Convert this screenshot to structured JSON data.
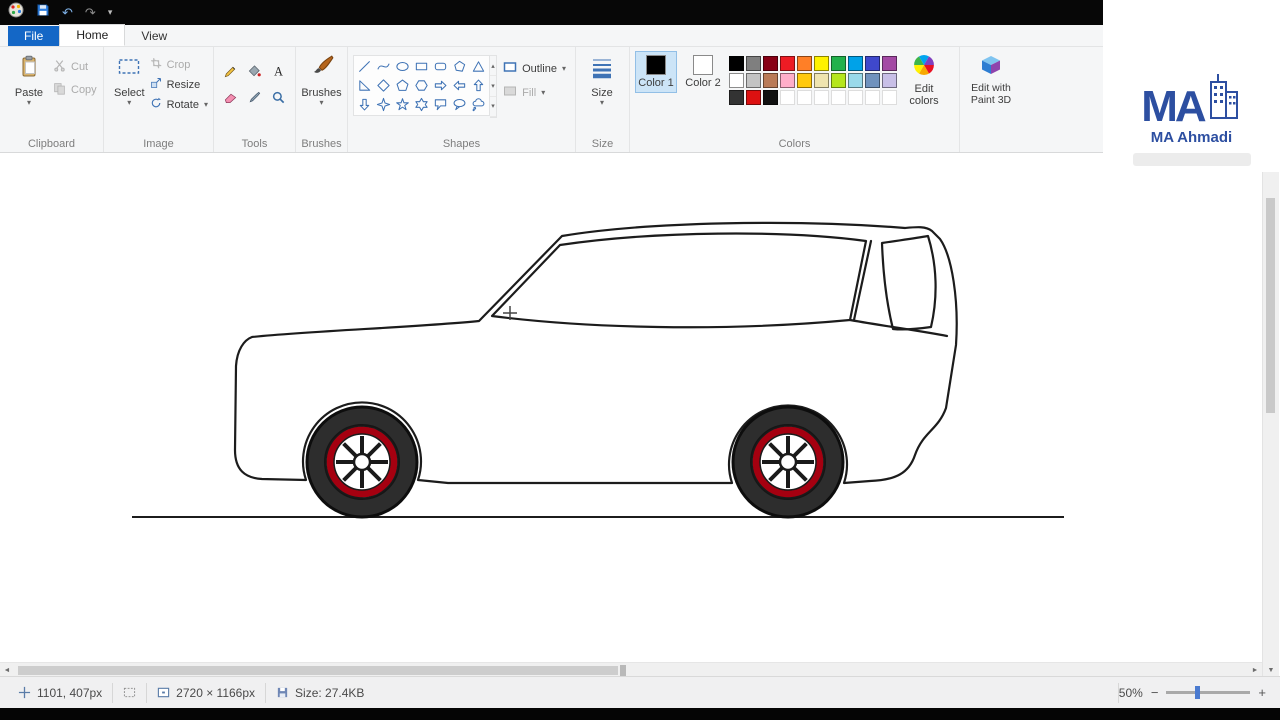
{
  "app": {
    "title": "Paint"
  },
  "titlebar": {
    "undo_glyph": "↶",
    "redo_glyph": "↷",
    "dropdown_glyph": "▾"
  },
  "tabs": {
    "file": "File",
    "home": "Home",
    "view": "View"
  },
  "ui": {
    "caret": "▾",
    "gallery_up": "▴",
    "gallery_down": "▾",
    "gallery_more": "▾"
  },
  "ribbon": {
    "clipboard": {
      "label": "Clipboard",
      "paste": "Paste",
      "cut": "Cut",
      "copy": "Copy"
    },
    "image": {
      "label": "Image",
      "select": "Select",
      "crop": "Crop",
      "resize": "Resize",
      "rotate": "Rotate"
    },
    "tools": {
      "label": "Tools",
      "items": [
        "pencil",
        "fill",
        "text",
        "eraser",
        "color-picker",
        "magnifier"
      ]
    },
    "brushes": {
      "label": "Brushes"
    },
    "shapes": {
      "label": "Shapes",
      "outline": "Outline",
      "fill": "Fill",
      "items": [
        "line",
        "curve",
        "oval",
        "rectangle",
        "rounded-rectangle",
        "polygon",
        "triangle",
        "right-triangle",
        "diamond",
        "pentagon",
        "hexagon",
        "arrow-right",
        "arrow-left",
        "arrow-up",
        "arrow-down",
        "star-4",
        "star-5",
        "star-6",
        "callout-rectangle",
        "callout-oval",
        "callout-cloud"
      ]
    },
    "size": {
      "label": "Size"
    },
    "colors": {
      "label": "Colors",
      "color1_label": "Color 1",
      "color1_value": "#000000",
      "color2_label": "Color 2",
      "color2_value": "#ffffff",
      "edit_colors": "Edit colors",
      "palette": {
        "row1": [
          "#000000",
          "#7f7f7f",
          "#880015",
          "#ed1c24",
          "#ff7f27",
          "#fff200",
          "#22b14c",
          "#00a2e8",
          "#3f48cc",
          "#a349a4"
        ],
        "row2": [
          "#ffffff",
          "#c3c3c3",
          "#b97a57",
          "#ffaec9",
          "#ffc90e",
          "#efe4b0",
          "#b5e61d",
          "#99d9ea",
          "#7092be",
          "#c8bfe7"
        ],
        "row3": [
          "#333333",
          "#dd1111",
          "#111111",
          "",
          "",
          "",
          "",
          "",
          "",
          ""
        ]
      }
    },
    "paint3d_label": "Edit with Paint 3D"
  },
  "watermark": {
    "monogram": "MA",
    "brand": "MA Ahmadi"
  },
  "scrollbar": {
    "left_arrow": "◄",
    "right_arrow": "►",
    "up_arrow": "▲",
    "down_arrow": "▼"
  },
  "statusbar": {
    "cursor_position": "1101, 407px",
    "canvas_size": "2720 × 1166px",
    "file_size": "Size: 27.4KB",
    "zoom": "50%",
    "zoom_minus": "−",
    "zoom_plus": "+"
  }
}
